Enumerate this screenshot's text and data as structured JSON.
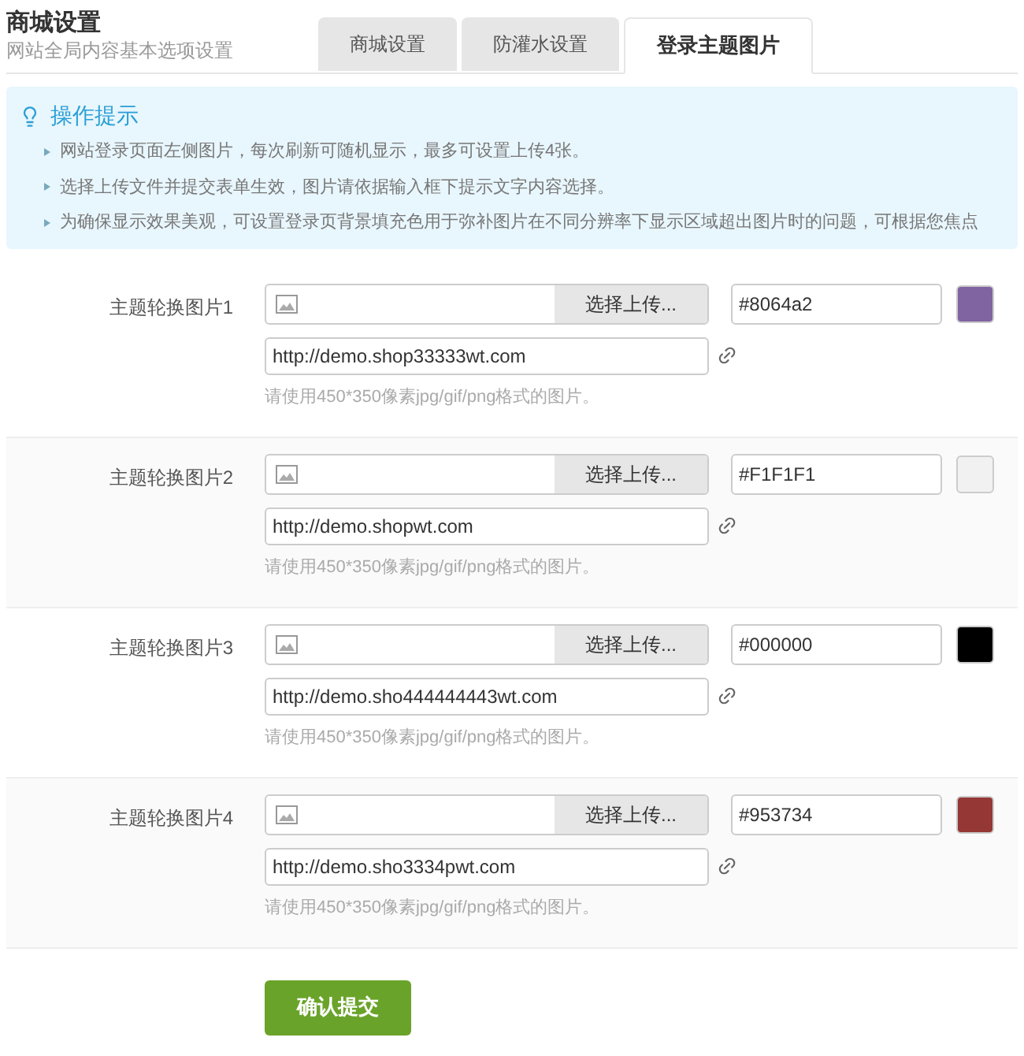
{
  "header": {
    "title": "商城设置",
    "subtitle": "网站全局内容基本选项设置"
  },
  "tabs": [
    {
      "label": "商城设置",
      "selected": false
    },
    {
      "label": "防灌水设置",
      "selected": false
    },
    {
      "label": "登录主题图片",
      "selected": true
    }
  ],
  "tips": {
    "title": "操作提示",
    "items": [
      "网站登录页面左侧图片，每次刷新可随机显示，最多可设置上传4张。",
      "选择上传文件并提交表单生效，图片请依据输入框下提示文字内容选择。",
      "为确保显示效果美观，可设置登录页背景填充色用于弥补图片在不同分辨率下显示区域超出图片时的问题，可根据您焦点"
    ]
  },
  "rows": [
    {
      "label": "主题轮换图片1",
      "upload_button": "选择上传...",
      "color_value": "#8064a2",
      "color": "#8064a2",
      "url": "http://demo.shop33333wt.com",
      "hint": "请使用450*350像素jpg/gif/png格式的图片。"
    },
    {
      "label": "主题轮换图片2",
      "upload_button": "选择上传...",
      "color_value": "#F1F1F1",
      "color": "#f1f1f1",
      "url": "http://demo.shopwt.com",
      "hint": "请使用450*350像素jpg/gif/png格式的图片。"
    },
    {
      "label": "主题轮换图片3",
      "upload_button": "选择上传...",
      "color_value": "#000000",
      "color": "#000000",
      "url": "http://demo.sho444444443wt.com",
      "hint": "请使用450*350像素jpg/gif/png格式的图片。"
    },
    {
      "label": "主题轮换图片4",
      "upload_button": "选择上传...",
      "color_value": "#953734",
      "color": "#953734",
      "url": "http://demo.sho3334pwt.com",
      "hint": "请使用450*350像素jpg/gif/png格式的图片。"
    }
  ],
  "submit": "确认提交"
}
